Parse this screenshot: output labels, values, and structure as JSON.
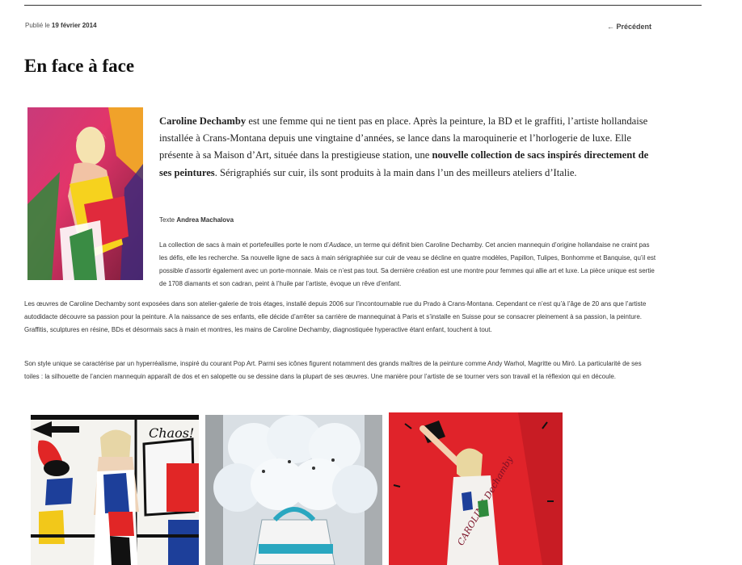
{
  "post_meta": {
    "published_prefix": "Publié le",
    "date": "19 février 2014",
    "prev_link": "← Précédent"
  },
  "article": {
    "title": "En face à face",
    "lead_strong_name": "Caroline Dechamby",
    "lead_part1": " est une femme qui ne tient pas en place. Après la peinture, la BD et le graffiti, l’artiste hollandaise installée à Crans-Montana depuis une vingtaine d’années, se lance dans la maroquinerie et l’horlogerie de luxe. Elle présente à sa Maison d’Art, située dans la prestigieuse station, une ",
    "lead_strong_collection": "nouvelle collection de sacs inspirés directement de ses peintures",
    "lead_part2": ". Sérigraphiés sur cuir, ils sont produits à la main dans l’un des meilleurs ateliers d’Italie.",
    "credit_prefix": "Texte",
    "credit_author": "Andrea Machalova",
    "p1_before_em": "La collection de sacs à main et portefeuilles porte le nom d’",
    "p1_em": "Audace",
    "p1_after_em": ", un terme qui définit bien Caroline Dechamby. Cet ancien mannequin d’origine hollandaise ne craint pas les défis, elle les recherche. Sa nouvelle ligne de sacs à main sérigraphiée sur cuir de veau se décline en quatre modèles, Papillon, Tulipes, Bonhomme et Banquise, qu’il est possible d’assortir également avec un porte-monnaie. Mais ce n’est pas tout. Sa dernière création est une montre pour femmes qui allie art et luxe. La pièce unique est sertie de 1708 diamants et son cadran, peint à l’huile par l’artiste, évoque un rêve d’enfant.",
    "p2": "Les œuvres de Caroline Dechamby sont exposées dans son atelier-galerie de trois étages, installé depuis 2006 sur l’incontournable rue du Prado à Crans-Montana. Cependant ce n’est qu’à l’âge de 20 ans que l’artiste autodidacte découvre sa passion pour la peinture. A la naissance de ses enfants, elle décide d’arrêter sa carrière de mannequinat à Paris et s’installe en Suisse pour se consacrer pleinement à sa passion, la peinture. Graffitis, sculptures en résine, BDs et désormais sacs à main et montres, les mains de Caroline Dechamby, diagnostiquée hyperactive étant enfant, touchent à tout.",
    "p3": "Son style unique se caractérise par un hyperréalisme, inspiré du courant Pop Art. Parmi ses icônes figurent notamment des grands maîtres de la peinture comme Andy Warhol, Magritte ou Miró. La particularité de ses toiles : la silhouette de l’ancien mannequin apparaît de dos et en salopette ou se dessine dans la plupart de ses œuvres. Une manière pour l’artiste de se tourner vers son travail et la réflexion qui en découle."
  },
  "gallery": {
    "image1_text": "Chaos!",
    "image3_text": "CAROLINE Dechamby"
  },
  "colors": {
    "accent_red": "#e0232a",
    "mondrian_blue": "#1d3f9a",
    "mondrian_yellow": "#f2c81a"
  }
}
